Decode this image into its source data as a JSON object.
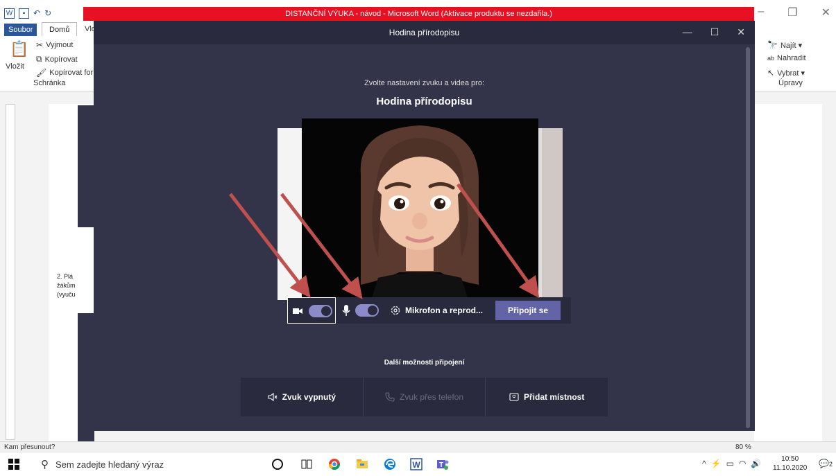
{
  "word": {
    "title": "DISTANČNÍ VÝUKA - návod - Microsoft Word (Aktivace produktu se nezdařila.)",
    "tabs": {
      "file": "Soubor",
      "home": "Domů",
      "more": "Vlo"
    },
    "ribbon": {
      "paste": "Vložit",
      "cut": "Vyjmout",
      "copy": "Kopírovat",
      "format_painter": "Kopírovat forma",
      "clipboard_group": "Schránka",
      "find": "Najít ▾",
      "replace": "Nahradit",
      "select": "Vybrat ▾",
      "editing_group": "Úpravy"
    },
    "doc_text": [
      "2. Plá",
      "žákům",
      "(vyuču"
    ],
    "status_left": "Kam přesunout?",
    "zoom": "80 %"
  },
  "teams": {
    "window_title": "Hodina přírodopisu",
    "prompt": "Zvolte nastavení zvuku a videa pro:",
    "meeting_name": "Hodina přírodopisu",
    "controls": {
      "camera_on": true,
      "mic_on": true,
      "device_label": "Mikrofon a reprod...",
      "join_label": "Připojit se"
    },
    "more_options_label": "Další možnosti připojení",
    "options": [
      {
        "label": "Zvuk vypnutý",
        "icon": "speaker-muted-icon",
        "enabled": true
      },
      {
        "label": "Zvuk přes telefon",
        "icon": "phone-icon",
        "enabled": false
      },
      {
        "label": "Přidat místnost",
        "icon": "room-cast-icon",
        "enabled": true
      }
    ],
    "colors": {
      "bg": "#33344a",
      "panel": "#292a3e",
      "accent": "#6264a7",
      "toggle": "#8b8cc7",
      "arrow": "#c0504d"
    }
  },
  "taskbar": {
    "search_placeholder": "Sem zadejte hledaný výraz",
    "time": "10:50",
    "date": "11.10.2020",
    "notifications": "2"
  }
}
